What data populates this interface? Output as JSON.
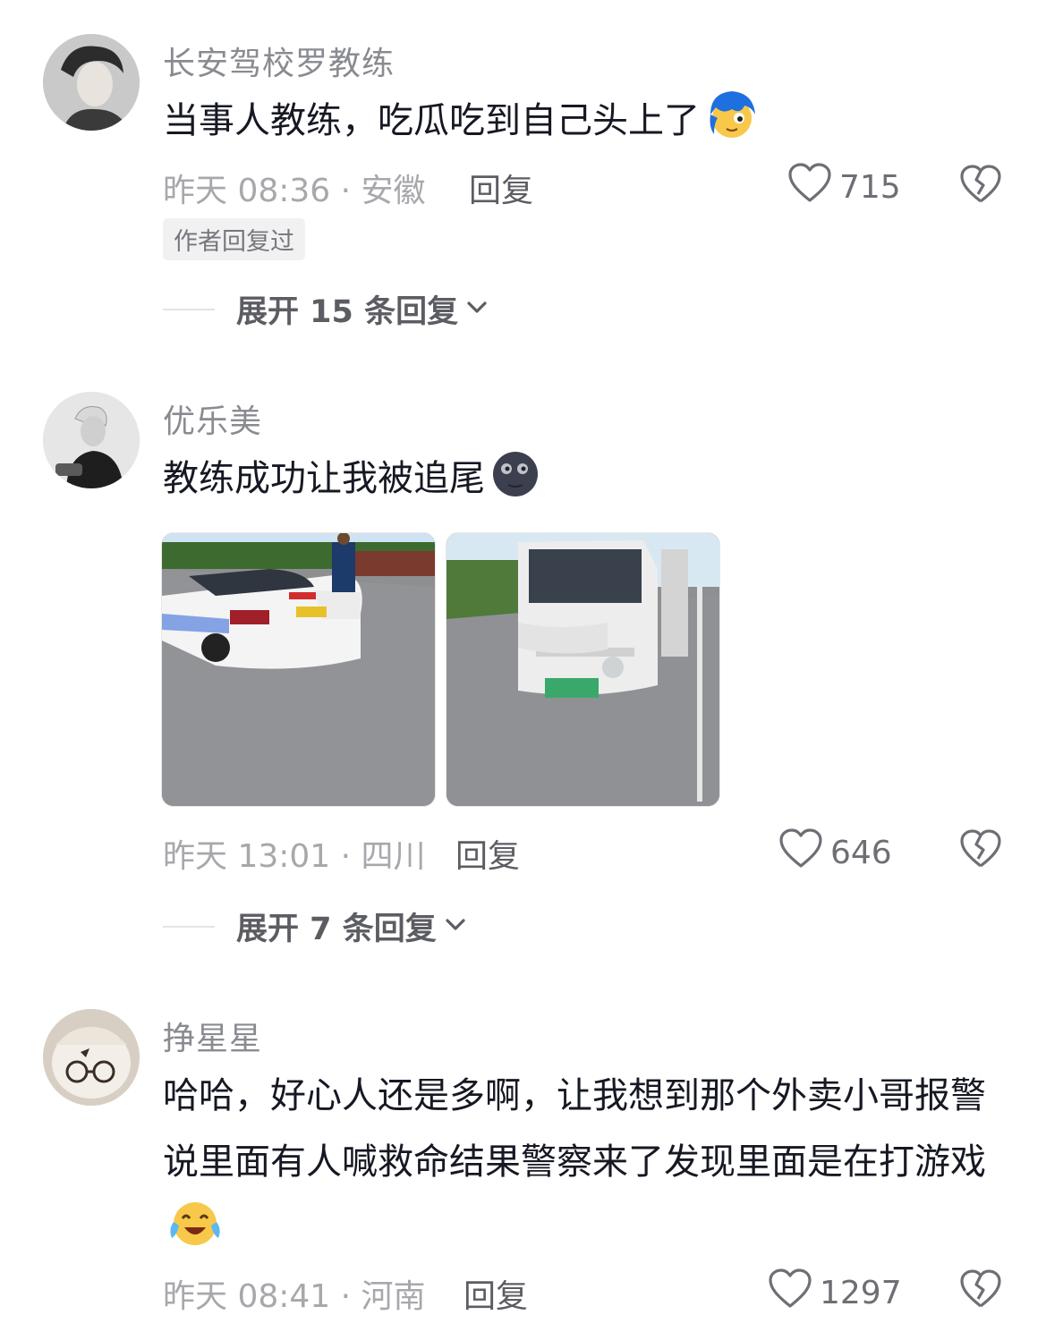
{
  "comments": [
    {
      "username": "长安驾校罗教练",
      "content": "当事人教练，吃瓜吃到自己头上了",
      "meta": "昨天 08:36 · 安徽",
      "reply_label": "回复",
      "likes": "715",
      "badge": "作者回复过",
      "expand_label": "展开 15 条回复"
    },
    {
      "username": "优乐美",
      "content": "教练成功让我被追尾",
      "images": [
        "rear-damaged-driving-school-car",
        "front-damaged-white-truck"
      ],
      "meta": "昨天 13:01 · 四川",
      "reply_label": "回复",
      "likes": "646",
      "expand_label": "展开 7 条回复"
    },
    {
      "username": "挣星星",
      "content": "哈哈，好心人还是多啊，让我想到那个外卖小哥报警说里面有人喊救命结果警察来了发现里面是在打游戏",
      "meta": "昨天 08:41 · 河南",
      "reply_label": "回复",
      "likes": "1297"
    }
  ],
  "icons": {
    "like": "heart-outline-icon",
    "dislike": "broken-heart-icon",
    "expand": "chevron-down-icon"
  },
  "colors": {
    "username": "#8a8b91",
    "meta": "#a7a8ac",
    "text": "#161823"
  }
}
